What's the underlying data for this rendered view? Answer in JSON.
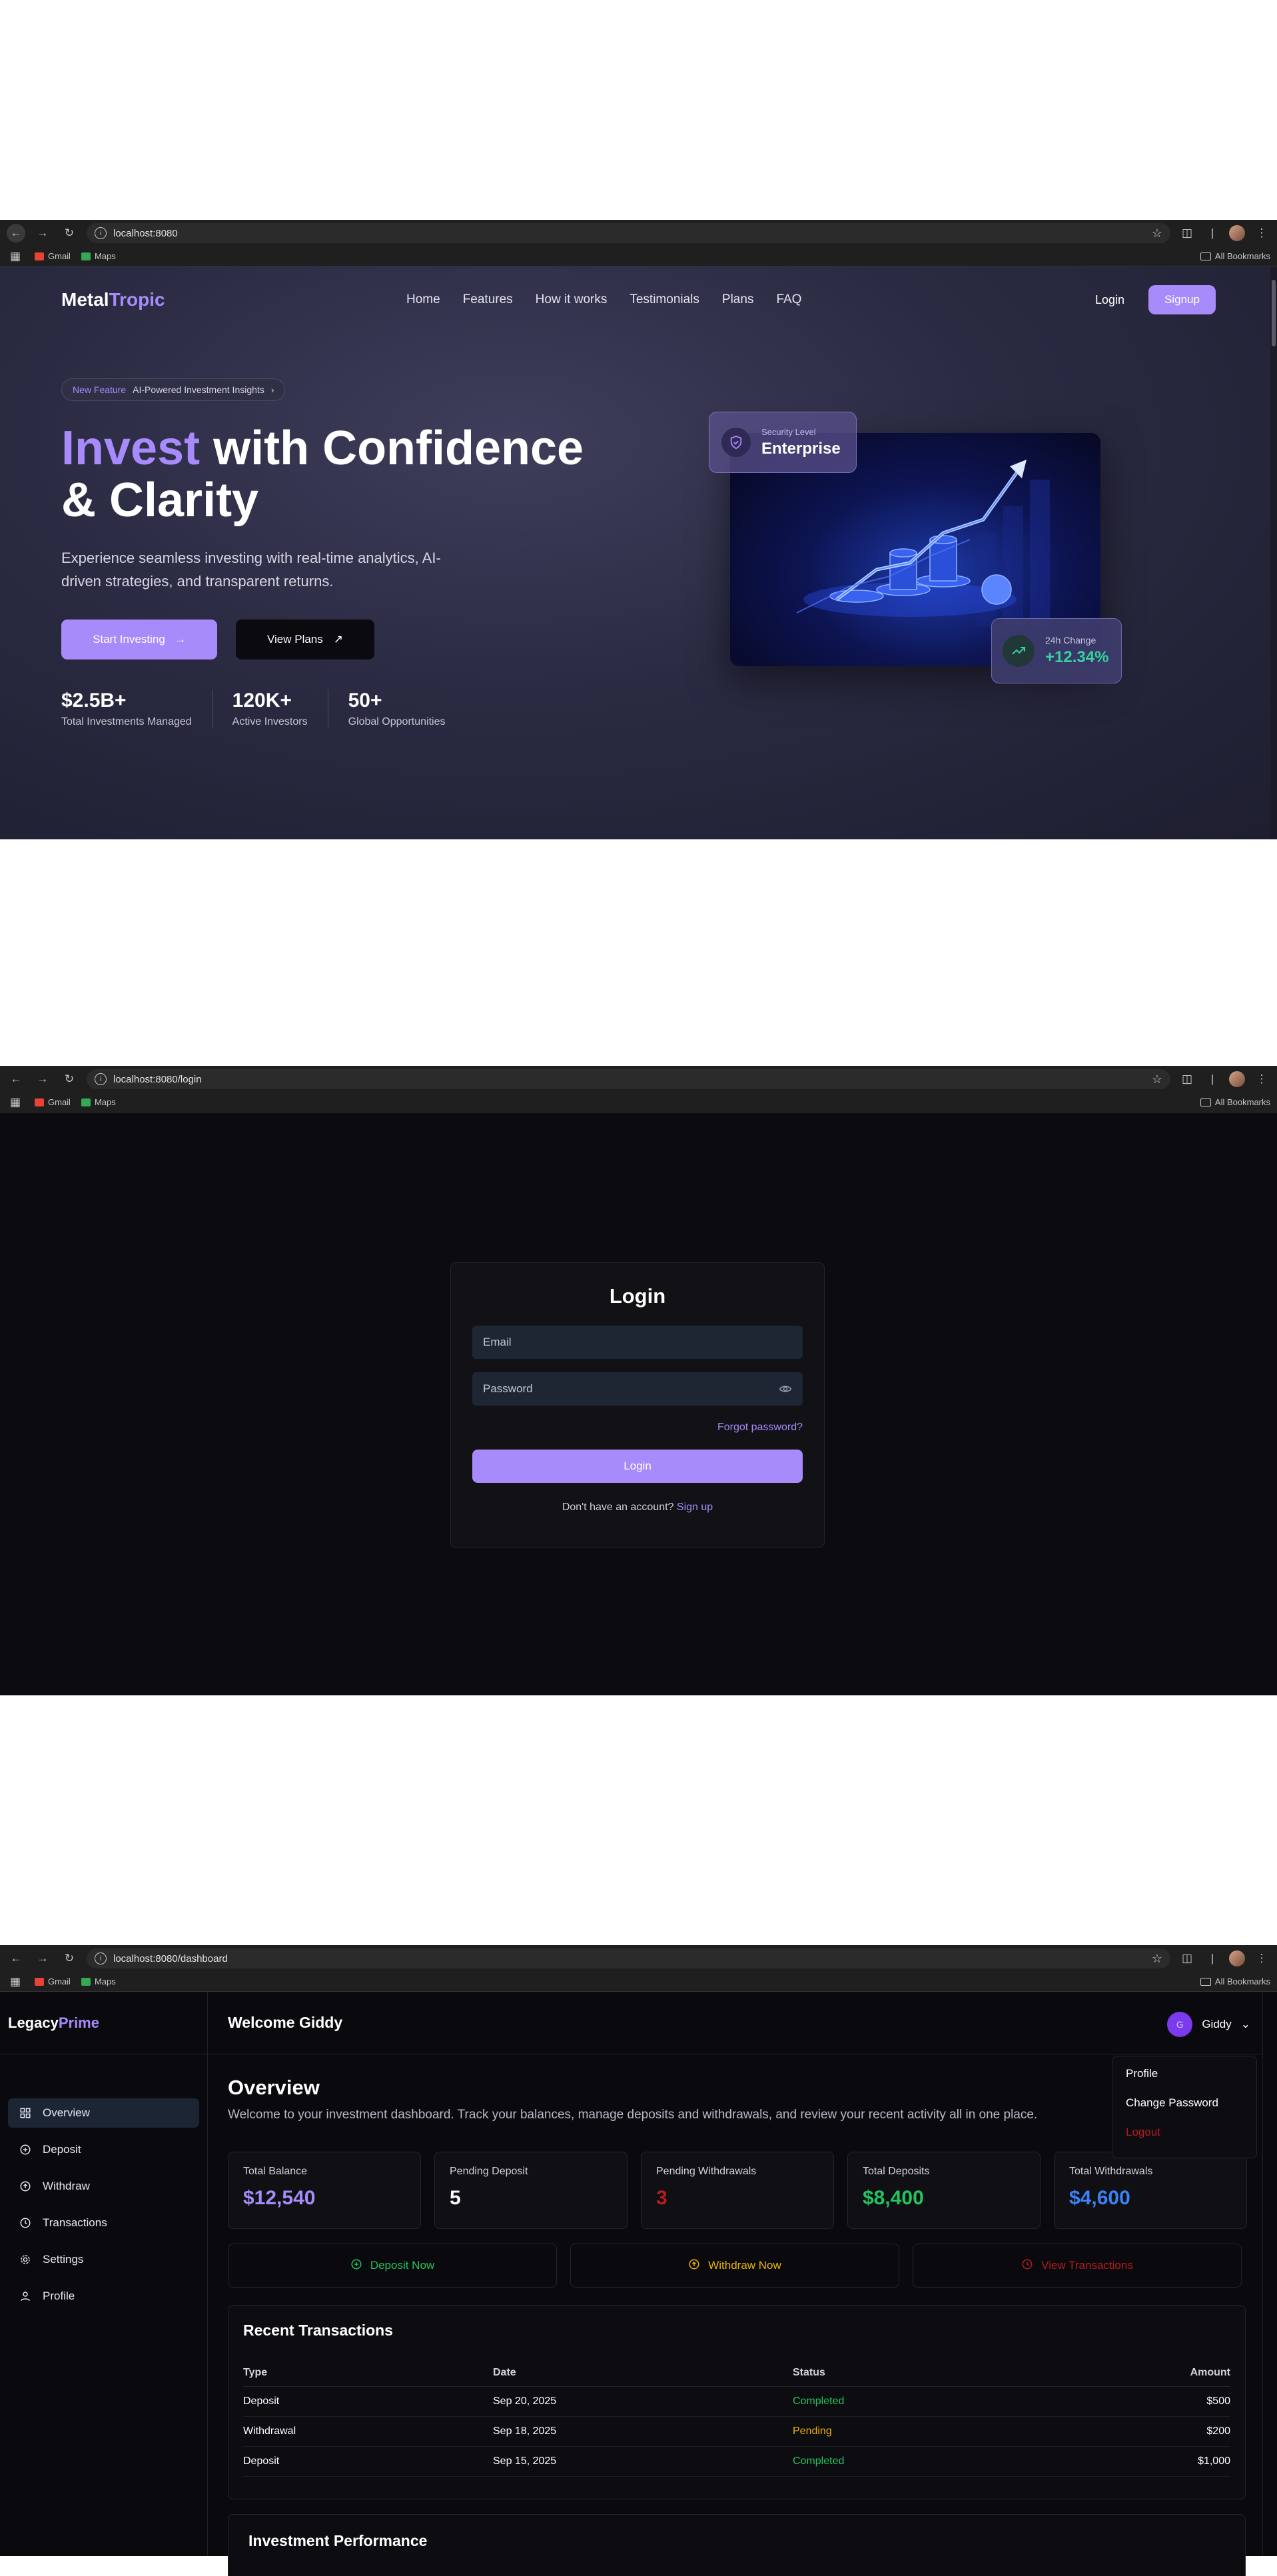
{
  "landing": {
    "browser": {
      "url": "localhost:8080"
    },
    "bookmarks": {
      "gmail": "Gmail",
      "maps": "Maps",
      "all": "All Bookmarks"
    },
    "logo": {
      "part1": "Metal",
      "part2": "Tropic"
    },
    "nav": [
      "Home",
      "Features",
      "How it works",
      "Testimonials",
      "Plans",
      "FAQ"
    ],
    "login_label": "Login",
    "signup_label": "Signup",
    "badge": {
      "tag": "New Feature",
      "text": "AI-Powered Investment Insights"
    },
    "headline": {
      "highlight": "Invest",
      "rest1": " with Confidence",
      "rest2": "& Clarity"
    },
    "subtext": "Experience seamless investing with real-time analytics, AI-driven strategies, and transparent returns.",
    "cta_primary": "Start Investing",
    "cta_secondary": "View Plans",
    "stats": [
      {
        "value": "$2.5B+",
        "label": "Total Investments Managed"
      },
      {
        "value": "120K+",
        "label": "Active Investors"
      },
      {
        "value": "50+",
        "label": "Global Opportunities"
      }
    ],
    "security_card": {
      "label": "Security Level",
      "value": "Enterprise"
    },
    "change_card": {
      "label": "24h Change",
      "value": "+12.34%"
    }
  },
  "login": {
    "browser": {
      "url": "localhost:8080/login"
    },
    "bookmarks": {
      "gmail": "Gmail",
      "maps": "Maps",
      "all": "All Bookmarks"
    },
    "title": "Login",
    "email_placeholder": "Email",
    "password_placeholder": "Password",
    "forgot": "Forgot password?",
    "button": "Login",
    "no_account": "Don't have an account?",
    "signup_link": "Sign up"
  },
  "dashboard": {
    "browser": {
      "url": "localhost:8080/dashboard"
    },
    "bookmarks": {
      "gmail": "Gmail",
      "maps": "Maps",
      "all": "All Bookmarks"
    },
    "logo": {
      "part1": "Legacy",
      "part2": "Prime"
    },
    "sidebar": [
      "Overview",
      "Deposit",
      "Withdraw",
      "Transactions",
      "Settings",
      "Profile"
    ],
    "welcome": "Welcome Giddy",
    "user": {
      "initial": "G",
      "name": "Giddy"
    },
    "menu": [
      "Profile",
      "Change Password",
      "Logout"
    ],
    "overview_title": "Overview",
    "overview_desc": "Welcome to your investment dashboard. Track your balances, manage deposits and withdrawals, and review your recent activity all in one place.",
    "cards": [
      {
        "label": "Total Balance",
        "value": "$12,540",
        "color": "#a78bfa"
      },
      {
        "label": "Pending Deposit",
        "value": "5",
        "color": "#ffffff"
      },
      {
        "label": "Pending Withdrawals",
        "value": "3",
        "color": "#b91c1c"
      },
      {
        "label": "Total Deposits",
        "value": "$8,400",
        "color": "#22c55e"
      },
      {
        "label": "Total Withdrawals",
        "value": "$4,600",
        "color": "#3b82f6"
      }
    ],
    "actions": [
      {
        "label": "Deposit Now",
        "color": "#22c55e"
      },
      {
        "label": "Withdraw Now",
        "color": "#eab308"
      },
      {
        "label": "View Transactions",
        "color": "#b91c1c"
      }
    ],
    "recent_title": "Recent Transactions",
    "table": {
      "headers": [
        "Type",
        "Date",
        "Status",
        "Amount"
      ],
      "rows": [
        {
          "type": "Deposit",
          "date": "Sep 20, 2025",
          "status": "Completed",
          "amount": "$500"
        },
        {
          "type": "Withdrawal",
          "date": "Sep 18, 2025",
          "status": "Pending",
          "amount": "$200"
        },
        {
          "type": "Deposit",
          "date": "Sep 15, 2025",
          "status": "Completed",
          "amount": "$1,000"
        }
      ]
    },
    "performance_title": "Investment Performance"
  }
}
